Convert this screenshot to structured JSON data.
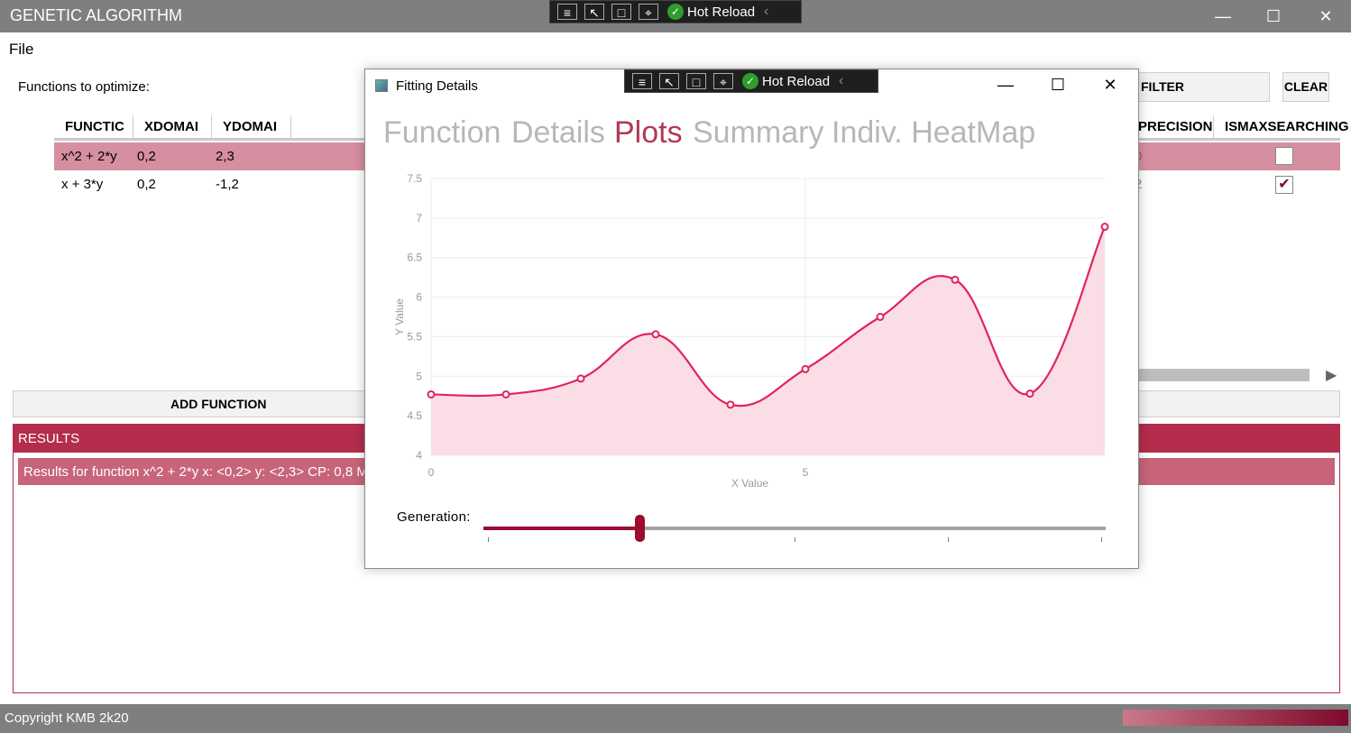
{
  "window": {
    "title": "GENETIC ALGORITHM",
    "minimize": "—",
    "maximize": "☐",
    "close": "✕"
  },
  "hot_reload": {
    "label": "Hot Reload"
  },
  "menu": {
    "file": "File"
  },
  "functions_label": "Functions to optimize:",
  "grid": {
    "columns": [
      "FUNCTIC",
      "XDOMAI",
      "YDOMAI",
      "PRECISION",
      "ISMAXSEARCHING"
    ],
    "rows": [
      {
        "function": "x^2 + 2*y",
        "xdomain": "0,2",
        "ydomain": "2,3",
        "precision_frag": "0",
        "ismaxsearching": false,
        "selected": true
      },
      {
        "function": "x + 3*y",
        "xdomain": "0,2",
        "ydomain": "-1,2",
        "precision_frag": "2",
        "ismaxsearching": true,
        "selected": false
      }
    ]
  },
  "buttons": {
    "filter": "FILTER",
    "clear": "CLEAR",
    "add_function": "ADD FUNCTION"
  },
  "results": {
    "title": "RESULTS",
    "item": "Results for function  x^2 + 2*y x: <0,2> y: <2,3> CP: 0,8 M"
  },
  "status": {
    "copyright": "Copyright KMB 2k20",
    "progress": 1.0
  },
  "dialog": {
    "title": "Fitting Details",
    "minimize": "—",
    "maximize": "☐",
    "close": "✕",
    "tabs": [
      "Function",
      "Details",
      "Plots",
      "Summary",
      "Indiv. HeatMap"
    ],
    "active_tab": 2,
    "generation_label": "Generation:",
    "slider_value": 0.25
  },
  "colors": {
    "accent": "#b42d4c",
    "line": "#e0245e",
    "fill": "#fbdde6",
    "slider": "#9d0b30"
  },
  "chart_data": {
    "type": "area",
    "xlabel": "X Value",
    "ylabel": "Y Value",
    "x_ticks": [
      0,
      5
    ],
    "y_ticks": [
      4,
      4.5,
      5,
      5.5,
      6,
      6.5,
      7,
      7.5
    ],
    "xlim": [
      0,
      9
    ],
    "ylim": [
      4,
      7.5
    ],
    "grid": true,
    "x": [
      0,
      1,
      2,
      3,
      4,
      5,
      6,
      7,
      8,
      9
    ],
    "values": [
      4.77,
      4.77,
      4.97,
      5.53,
      4.64,
      5.09,
      5.75,
      6.22,
      4.78,
      6.89
    ]
  }
}
